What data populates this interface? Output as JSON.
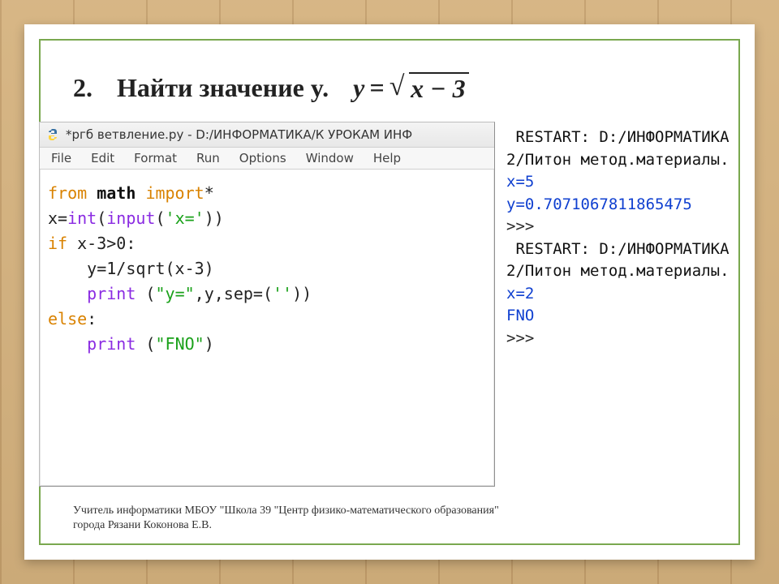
{
  "slide": {
    "number": "2.",
    "title": "Найти значение y.",
    "formula": {
      "lhs": "y",
      "eq": "=",
      "radicand": "x − 3",
      "sqrt_sym": "√"
    }
  },
  "editor": {
    "title": "*ргб ветвление.ру - D:/ИНФОРМАТИКА/К УРОКАМ ИНФ",
    "menus": [
      "File",
      "Edit",
      "Format",
      "Run",
      "Options",
      "Window",
      "Help"
    ],
    "code": {
      "l1_kw_from": "from",
      "l1_mod": "math",
      "l1_kw_import": "import",
      "l1_star": "*",
      "l2_var": "x=",
      "l2_int": "int",
      "l2_open": "(",
      "l2_input": "input",
      "l2_paren": "(",
      "l2_str": "'x='",
      "l2_close": "))",
      "l3_kw": "if",
      "l3_cond": " x-3>0:",
      "l4_indent": "    ",
      "l4_body": "y=1/sqrt(x-3)",
      "l5_indent": "    ",
      "l5_print": "print",
      "l5_args": " (",
      "l5_str1": "\"y=\"",
      "l5_mid": ",y,sep=(",
      "l5_str2": "''",
      "l5_end": "))",
      "l6_kw": "else",
      "l6_colon": ":",
      "l7_indent": "    ",
      "l7_print": "print",
      "l7_args": " (",
      "l7_str": "\"FNO\"",
      "l7_end": ")"
    }
  },
  "shell": {
    "line1": " RESTART: D:/ИНФОРМАТИКА",
    "line2": "2/Питон метод.материалы.",
    "line3": "x=5",
    "line4": "y=0.7071067811865475",
    "line5": ">>> ",
    "line6": " RESTART: D:/ИНФОРМАТИКА",
    "line7": "2/Питон метод.материалы.",
    "line8": "x=2",
    "line9": "FNO",
    "line10": ">>> "
  },
  "footer_l1": "Учитель информатики МБОУ \"Школа 39 \"Центр физико-математического образования\"",
  "footer_l2": "города Рязани Коконова Е.В."
}
